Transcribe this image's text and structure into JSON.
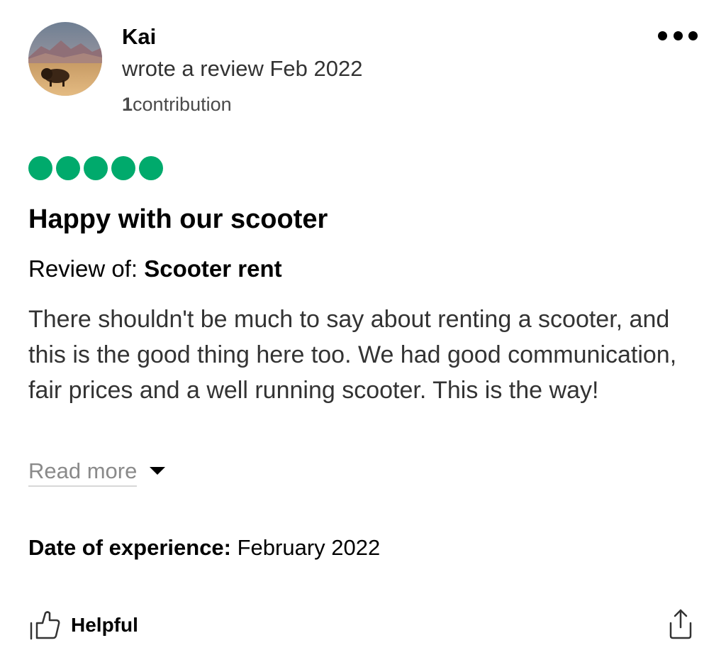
{
  "reviewer": {
    "name": "Kai",
    "meta": "wrote a review Feb 2022",
    "contributions_count": "1",
    "contributions_label": "contribution"
  },
  "rating": {
    "value": 5,
    "max": 5,
    "color": "#00aa6c"
  },
  "review": {
    "title": "Happy with our scooter",
    "review_of_label": "Review of:",
    "review_of_target": "Scooter rent",
    "body": "There shouldn't be much to say about renting a scooter, and this is the good thing here too. We had good communication, fair prices and a well running scooter. This is the way!",
    "read_more_label": "Read more",
    "date_label": "Date of experience:",
    "date_value": "February 2022"
  },
  "actions": {
    "helpful_label": "Helpful",
    "more_icon": "more-horizontal-icon",
    "helpful_icon": "thumbs-up-icon",
    "share_icon": "share-icon",
    "expand_icon": "caret-down-icon"
  }
}
